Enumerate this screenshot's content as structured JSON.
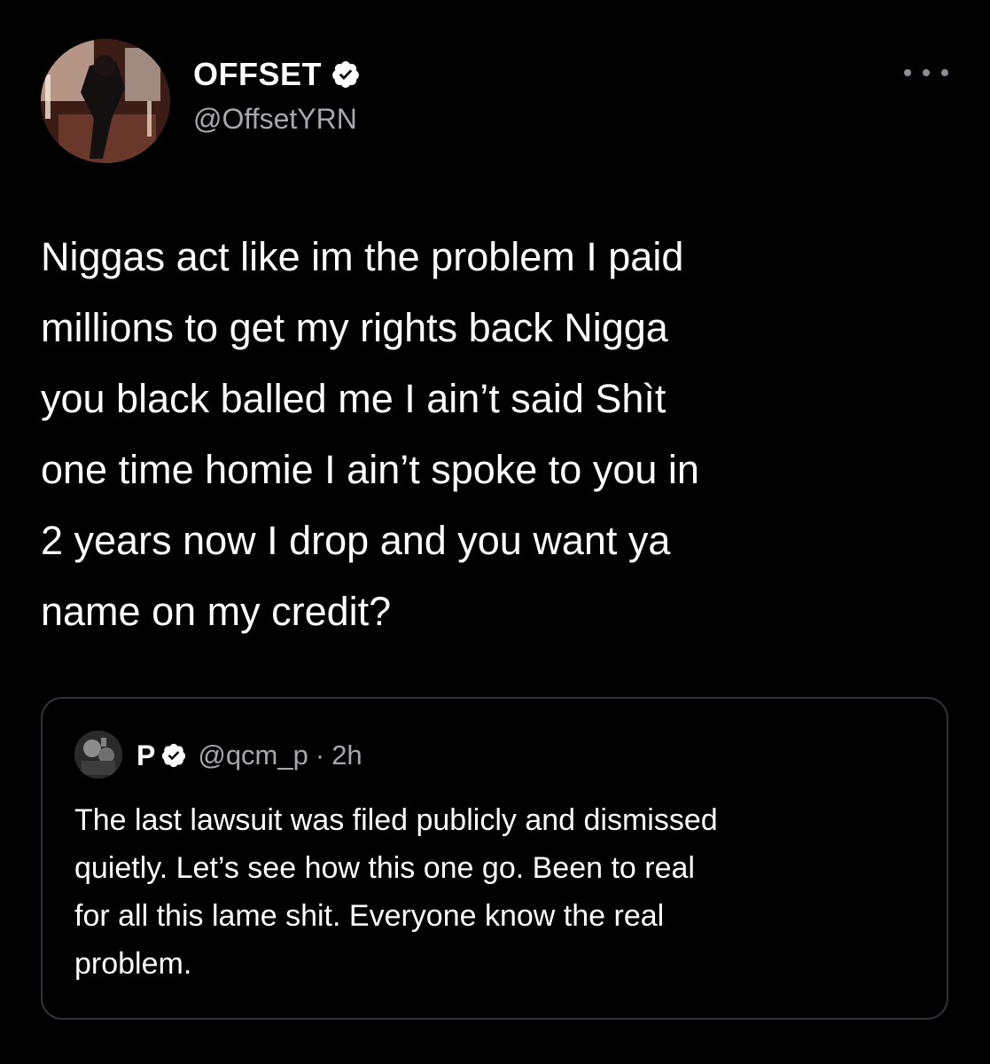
{
  "author": {
    "display_name": "OFFSET",
    "handle": "@OffsetYRN",
    "verified_icon": "verified-badge-icon",
    "avatar_icon": "profile-photo"
  },
  "more_icon": "more-options-icon",
  "tweet": {
    "text": "Niggas act like im the problem I paid\nmillions to get my rights back  Nigga\nyou black balled me I ain’t said Shìt\none time homie I ain’t spoke to you in\n2 years now I drop and you want ya\nname on my credit?"
  },
  "quoted_tweet": {
    "display_name": "P",
    "handle": "@qcm_p",
    "separator": "·",
    "time": "2h",
    "text": "The last lawsuit was filed publicly and dismissed\nquietly. Let’s see how this one go. Been to real\nfor all this lame shit. Everyone know the real\nproblem."
  },
  "colors": {
    "background": "#000000",
    "text_primary": "#ffffff",
    "text_secondary": "#a5a9ad",
    "border": "#2f3336",
    "verified_badge": "#ffffff"
  }
}
